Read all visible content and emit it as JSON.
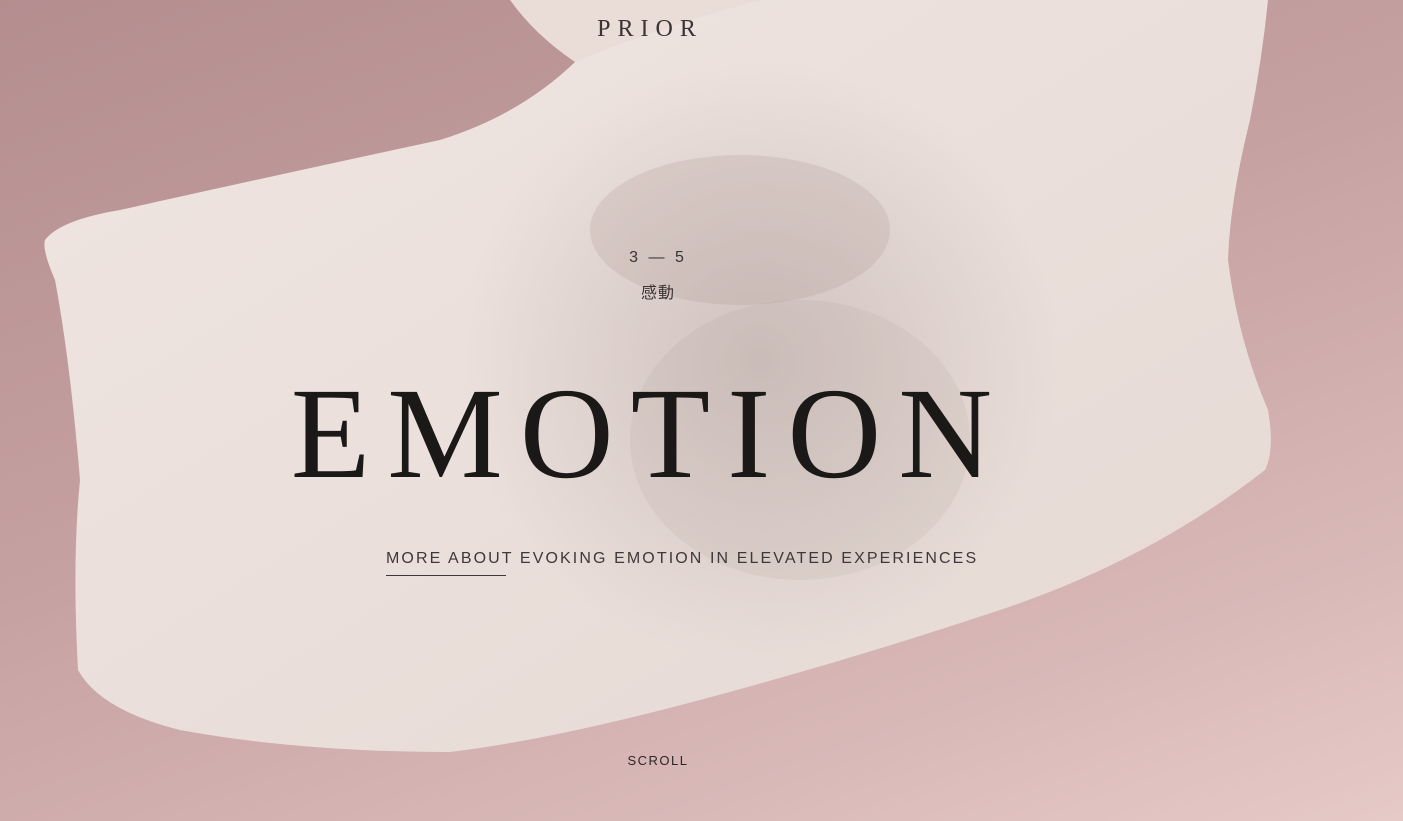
{
  "header": {
    "logo_text": "PRIOR"
  },
  "hero": {
    "counter": "3 — 5",
    "subtitle_jp": "感動",
    "headline": "EMOTION",
    "link_text": "MORE ABOUT EVOKING EMOTION IN ELEVATED EXPERIENCES"
  },
  "footer": {
    "scroll_label": "SCROLL"
  },
  "colors": {
    "background": "#c6a1a1",
    "ribbon": "#ece1dc",
    "text_dark": "#1b1818"
  }
}
